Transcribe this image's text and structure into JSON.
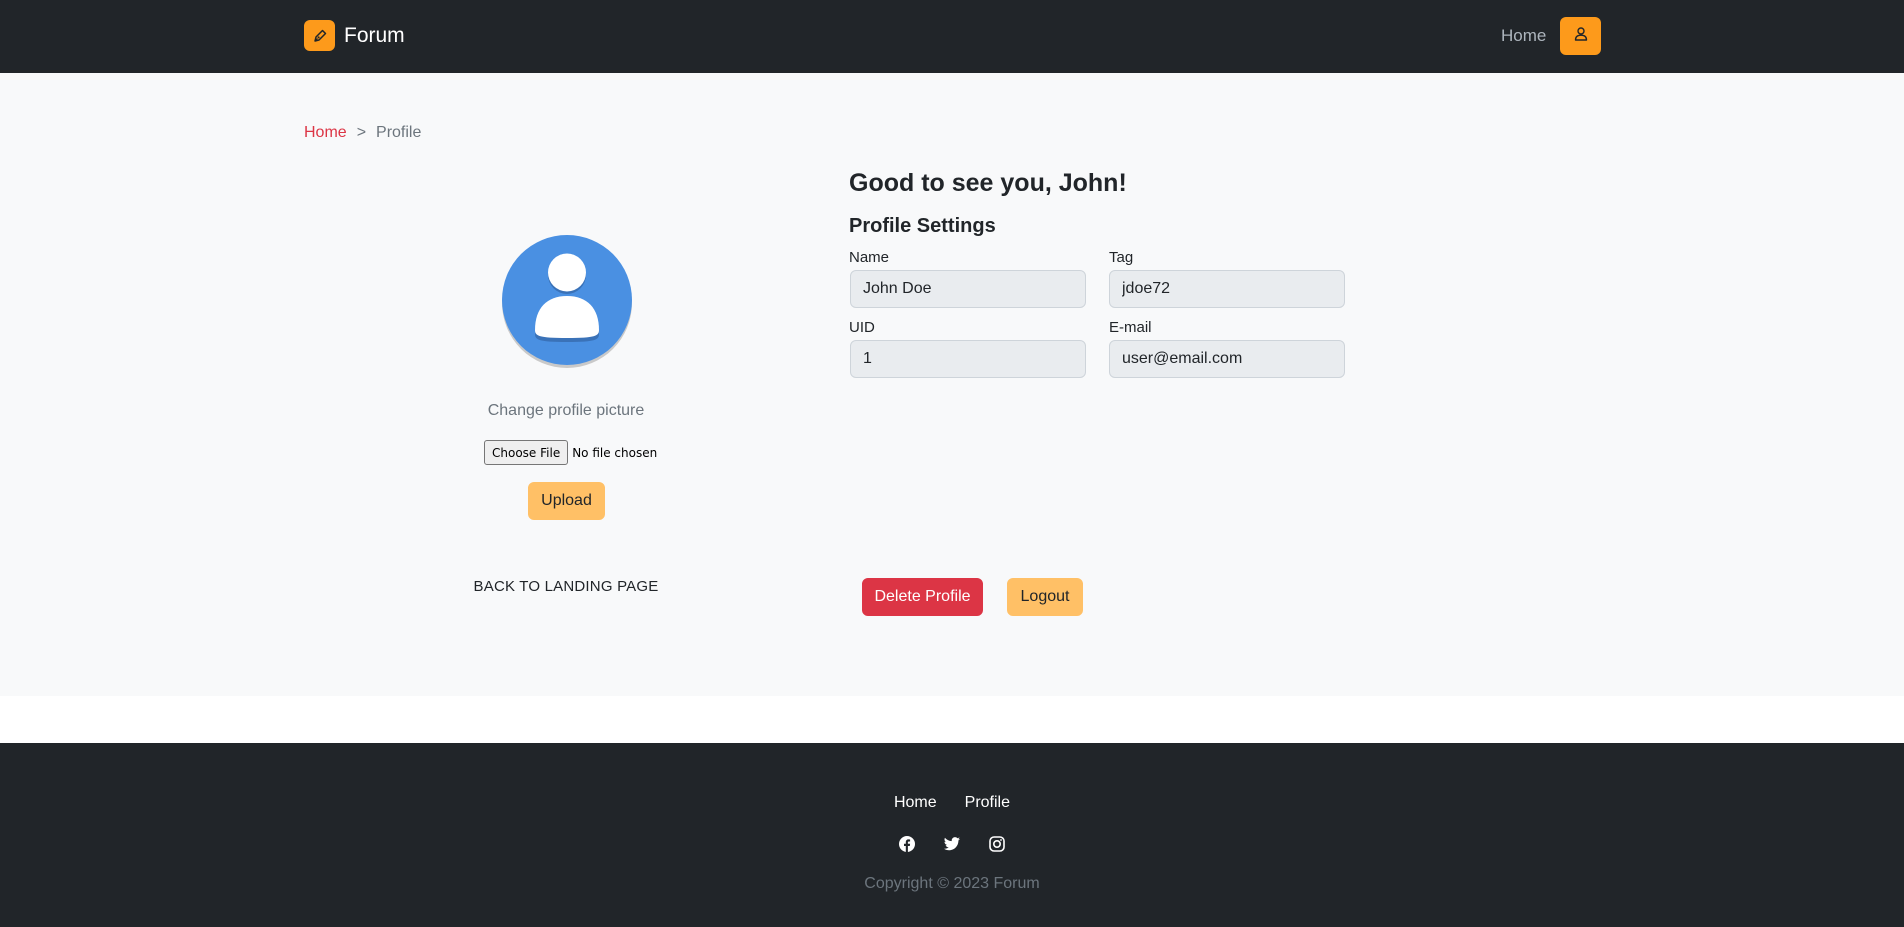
{
  "colors": {
    "navbar_bg": "#212529",
    "main_bg": "#f8f9fa",
    "brand_accent": "#fd9a1b",
    "warning_button": "#ffc066",
    "danger_button": "#dc3545",
    "avatar_blue": "#4a90e2",
    "breadcrumb_link": "#dc3545"
  },
  "navbar": {
    "brand_name": "Forum",
    "brand_icon": "pen-icon",
    "home_link": "Home",
    "user_icon": "user-icon"
  },
  "breadcrumb": {
    "home": "Home",
    "separator": ">",
    "current": "Profile"
  },
  "profile_picture": {
    "avatar_icon": "default-avatar-icon",
    "change_label": "Change profile picture",
    "choose_file_label": "Choose File",
    "file_status": "No file chosen",
    "upload_label": "Upload"
  },
  "back_link": "BACK TO LANDING PAGE",
  "settings": {
    "greeting": "Good to see you, John!",
    "title": "Profile Settings",
    "fields": {
      "name": {
        "label": "Name",
        "value": "John Doe"
      },
      "tag": {
        "label": "Tag",
        "value": "jdoe72"
      },
      "uid": {
        "label": "UID",
        "value": "1"
      },
      "email": {
        "label": "E-mail",
        "value": "user@email.com"
      }
    },
    "delete_label": "Delete Profile",
    "logout_label": "Logout"
  },
  "footer": {
    "links": [
      "Home",
      "Profile"
    ],
    "social_icons": [
      "facebook-icon",
      "twitter-icon",
      "instagram-icon"
    ],
    "copyright": "Copyright © 2023 Forum"
  }
}
